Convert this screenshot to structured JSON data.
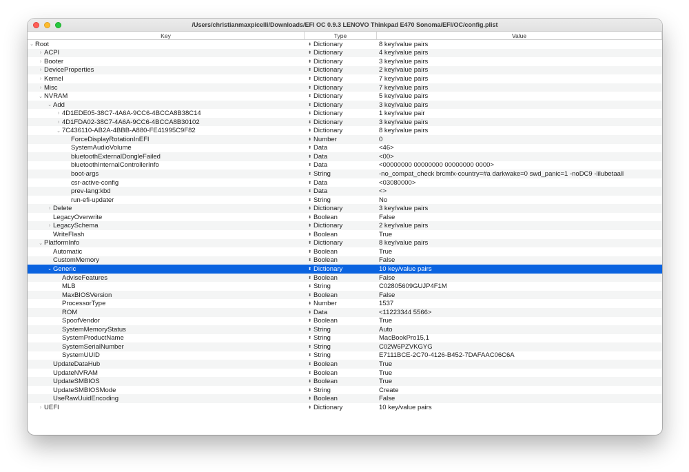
{
  "window": {
    "title": "/Users/christianmaxpicelli/Downloads/EFI OC 0.9.3 LENOVO Thinkpad E470 Sonoma/EFI/OC/config.plist"
  },
  "columns": {
    "key": "Key",
    "type": "Type",
    "value": "Value"
  },
  "rows": [
    {
      "key": "Root",
      "type": "Dictionary",
      "value": "8 key/value pairs",
      "level": 0,
      "expander": "open"
    },
    {
      "key": "ACPI",
      "type": "Dictionary",
      "value": "4 key/value pairs",
      "level": 1,
      "expander": "closed"
    },
    {
      "key": "Booter",
      "type": "Dictionary",
      "value": "3 key/value pairs",
      "level": 1,
      "expander": "closed"
    },
    {
      "key": "DeviceProperties",
      "type": "Dictionary",
      "value": "2 key/value pairs",
      "level": 1,
      "expander": "closed"
    },
    {
      "key": "Kernel",
      "type": "Dictionary",
      "value": "7 key/value pairs",
      "level": 1,
      "expander": "closed"
    },
    {
      "key": "Misc",
      "type": "Dictionary",
      "value": "7 key/value pairs",
      "level": 1,
      "expander": "closed"
    },
    {
      "key": "NVRAM",
      "type": "Dictionary",
      "value": "5 key/value pairs",
      "level": 1,
      "expander": "open"
    },
    {
      "key": "Add",
      "type": "Dictionary",
      "value": "3 key/value pairs",
      "level": 2,
      "expander": "open"
    },
    {
      "key": "4D1EDE05-38C7-4A6A-9CC6-4BCCA8B38C14",
      "type": "Dictionary",
      "value": "1 key/value pair",
      "level": 3,
      "expander": "closed"
    },
    {
      "key": "4D1FDA02-38C7-4A6A-9CC6-4BCCA8B30102",
      "type": "Dictionary",
      "value": "3 key/value pairs",
      "level": 3,
      "expander": "closed"
    },
    {
      "key": "7C436110-AB2A-4BBB-A880-FE41995C9F82",
      "type": "Dictionary",
      "value": "8 key/value pairs",
      "level": 3,
      "expander": "open"
    },
    {
      "key": "ForceDisplayRotationInEFI",
      "type": "Number",
      "value": "0",
      "level": 4,
      "expander": "none"
    },
    {
      "key": "SystemAudioVolume",
      "type": "Data",
      "value": "<46>",
      "level": 4,
      "expander": "none"
    },
    {
      "key": "bluetoothExternalDongleFailed",
      "type": "Data",
      "value": "<00>",
      "level": 4,
      "expander": "none"
    },
    {
      "key": "bluetoothInternalControllerInfo",
      "type": "Data",
      "value": "<00000000 00000000 00000000 0000>",
      "level": 4,
      "expander": "none"
    },
    {
      "key": "boot-args",
      "type": "String",
      "value": "-no_compat_check brcmfx-country=#a darkwake=0 swd_panic=1 -noDC9 -lilubetaall",
      "level": 4,
      "expander": "none"
    },
    {
      "key": "csr-active-config",
      "type": "Data",
      "value": "<03080000>",
      "level": 4,
      "expander": "none"
    },
    {
      "key": "prev-lang:kbd",
      "type": "Data",
      "value": "<>",
      "level": 4,
      "expander": "none"
    },
    {
      "key": "run-efi-updater",
      "type": "String",
      "value": "No",
      "level": 4,
      "expander": "none"
    },
    {
      "key": "Delete",
      "type": "Dictionary",
      "value": "3 key/value pairs",
      "level": 2,
      "expander": "closed"
    },
    {
      "key": "LegacyOverwrite",
      "type": "Boolean",
      "value": "False",
      "level": 2,
      "expander": "none"
    },
    {
      "key": "LegacySchema",
      "type": "Dictionary",
      "value": "2 key/value pairs",
      "level": 2,
      "expander": "closed"
    },
    {
      "key": "WriteFlash",
      "type": "Boolean",
      "value": "True",
      "level": 2,
      "expander": "none"
    },
    {
      "key": "PlatformInfo",
      "type": "Dictionary",
      "value": "8 key/value pairs",
      "level": 1,
      "expander": "open"
    },
    {
      "key": "Automatic",
      "type": "Boolean",
      "value": "True",
      "level": 2,
      "expander": "none"
    },
    {
      "key": "CustomMemory",
      "type": "Boolean",
      "value": "False",
      "level": 2,
      "expander": "none"
    },
    {
      "key": "Generic",
      "type": "Dictionary",
      "value": "10 key/value pairs",
      "level": 2,
      "expander": "open",
      "selected": true
    },
    {
      "key": "AdviseFeatures",
      "type": "Boolean",
      "value": "False",
      "level": 3,
      "expander": "none"
    },
    {
      "key": "MLB",
      "type": "String",
      "value": "C02805609GUJP4F1M",
      "level": 3,
      "expander": "none"
    },
    {
      "key": "MaxBIOSVersion",
      "type": "Boolean",
      "value": "False",
      "level": 3,
      "expander": "none"
    },
    {
      "key": "ProcessorType",
      "type": "Number",
      "value": "1537",
      "level": 3,
      "expander": "none"
    },
    {
      "key": "ROM",
      "type": "Data",
      "value": "<11223344 5566>",
      "level": 3,
      "expander": "none"
    },
    {
      "key": "SpoofVendor",
      "type": "Boolean",
      "value": "True",
      "level": 3,
      "expander": "none"
    },
    {
      "key": "SystemMemoryStatus",
      "type": "String",
      "value": "Auto",
      "level": 3,
      "expander": "none"
    },
    {
      "key": "SystemProductName",
      "type": "String",
      "value": "MacBookPro15,1",
      "level": 3,
      "expander": "none"
    },
    {
      "key": "SystemSerialNumber",
      "type": "String",
      "value": "C02W6PZVKGYG",
      "level": 3,
      "expander": "none"
    },
    {
      "key": "SystemUUID",
      "type": "String",
      "value": "E7111BCE-2C70-4126-B452-7DAFAAC06C6A",
      "level": 3,
      "expander": "none"
    },
    {
      "key": "UpdateDataHub",
      "type": "Boolean",
      "value": "True",
      "level": 2,
      "expander": "none"
    },
    {
      "key": "UpdateNVRAM",
      "type": "Boolean",
      "value": "True",
      "level": 2,
      "expander": "none"
    },
    {
      "key": "UpdateSMBIOS",
      "type": "Boolean",
      "value": "True",
      "level": 2,
      "expander": "none"
    },
    {
      "key": "UpdateSMBIOSMode",
      "type": "String",
      "value": "Create",
      "level": 2,
      "expander": "none"
    },
    {
      "key": "UseRawUuidEncoding",
      "type": "Boolean",
      "value": "False",
      "level": 2,
      "expander": "none"
    },
    {
      "key": "UEFI",
      "type": "Dictionary",
      "value": "10 key/value pairs",
      "level": 1,
      "expander": "closed"
    }
  ]
}
